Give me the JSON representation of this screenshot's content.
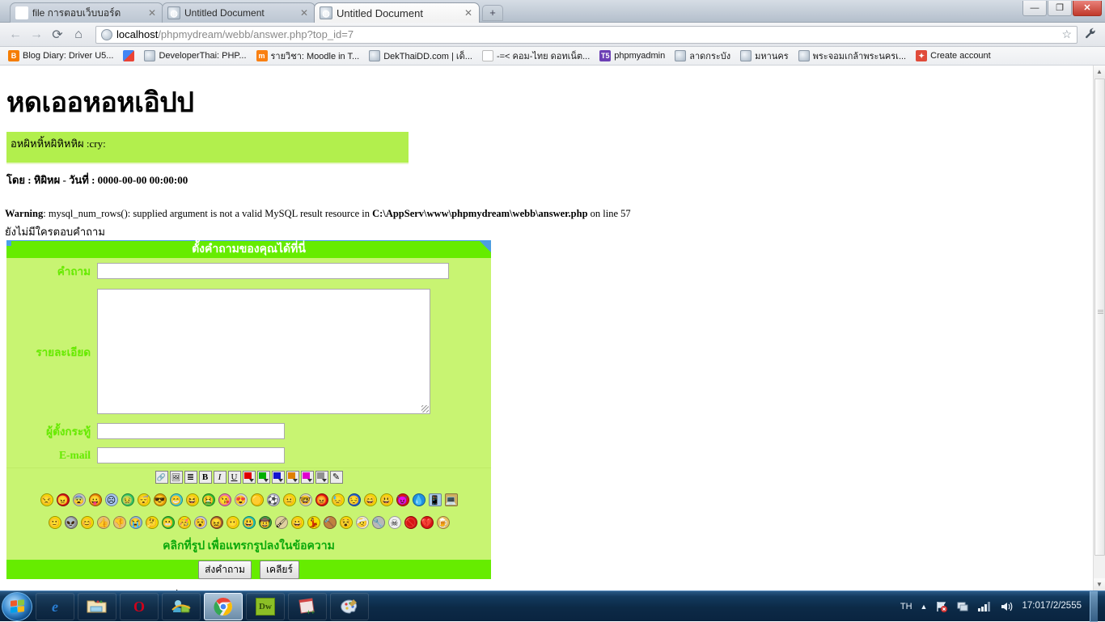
{
  "window": {
    "controls": {
      "minimize": "—",
      "maximize": "❐",
      "close": "✕"
    }
  },
  "tabs": [
    {
      "label": "file การตอบเว็บบอร์ด",
      "icon": "google-favicon",
      "active": false,
      "close": "✕"
    },
    {
      "label": "Untitled Document",
      "icon": "globe-favicon",
      "active": false,
      "close": "✕"
    },
    {
      "label": "Untitled Document",
      "icon": "globe-favicon",
      "active": true,
      "close": "✕"
    }
  ],
  "new_tab_label": "+",
  "nav": {
    "back_icon": "←",
    "forward_icon": "→",
    "reload_icon": "⟳",
    "home_icon": "⌂",
    "url_host": "localhost",
    "url_path": "/phpmydream/webb/answer.php?top_id=7",
    "url_full": "localhost/phpmydream/webb/answer.php?top_id=7",
    "star_icon": "☆",
    "wrench_icon": "🔧"
  },
  "bookmarks": [
    {
      "label": "Blog Diary: Driver U5...",
      "icon": "blogger-icon"
    },
    {
      "label": "",
      "icon": "google-icon"
    },
    {
      "label": "DeveloperThai: PHP...",
      "icon": "globe-icon"
    },
    {
      "label": "รายวิชา: Moodle in T...",
      "icon": "moodle-icon"
    },
    {
      "label": "DekThaiDD.com | เด็...",
      "icon": "globe-icon"
    },
    {
      "label": "-=< คอม-ไทย ดอทเน็ต...",
      "icon": "c-icon"
    },
    {
      "label": "phpmyadmin",
      "icon": "phpmyadmin-icon"
    },
    {
      "label": "ลาดกระบัง",
      "icon": "globe-icon"
    },
    {
      "label": "มหานคร",
      "icon": "globe-icon"
    },
    {
      "label": "พระจอมเกล้าพระนครเ...",
      "icon": "globe-icon"
    },
    {
      "label": "Create account",
      "icon": "account-icon"
    }
  ],
  "page": {
    "title": "หดเออหอหเอิปป",
    "post_text": "อหผิหหิ้หผิหิหหิผ :cry:",
    "post_meta": "โดย : หิผิหผ - วันที่ : 0000-00-00 00:00:00",
    "warning_prefix": "Warning",
    "warning_text": ": mysql_num_rows(): supplied argument is not a valid MySQL result resource in ",
    "warning_path": "C:\\AppServ\\www\\phpmydream\\webb\\answer.php",
    "warning_suffix": " on line 57",
    "no_answer_text": "ยังไม่มีใครตอบคำถาม"
  },
  "form": {
    "header": "ตั้งคำถามของคุณได้ที่นี่",
    "labels": {
      "question": "คำถาม",
      "detail": "รายละเอียด",
      "author": "ผู้ตั้งกระทู้",
      "email": "E-mail"
    },
    "values": {
      "question": "",
      "detail": "",
      "author": "",
      "email": ""
    },
    "toolbar": [
      {
        "name": "insert-link-icon",
        "glyph": "🔗"
      },
      {
        "name": "insert-image-icon",
        "glyph": "🖼"
      },
      {
        "name": "insert-list-icon",
        "glyph": "≣"
      },
      {
        "name": "bold-icon",
        "glyph": "B"
      },
      {
        "name": "italic-icon",
        "glyph": "I"
      },
      {
        "name": "underline-icon",
        "glyph": "U"
      },
      {
        "name": "color-red-icon",
        "color": "#e00000"
      },
      {
        "name": "color-green-icon",
        "color": "#00b000"
      },
      {
        "name": "color-blue-icon",
        "color": "#1414d0"
      },
      {
        "name": "color-orange-icon",
        "color": "#e08000"
      },
      {
        "name": "color-magenta-icon",
        "color": "#e000d0"
      },
      {
        "name": "color-gray-icon",
        "color": "#909090"
      },
      {
        "name": "edit-pencil-icon",
        "glyph": "✎"
      }
    ],
    "emoticons_row1": [
      {
        "name": "rolleyes-emoticon",
        "glyph": "😒",
        "bg": "#f5e000"
      },
      {
        "name": "mad-emoticon",
        "glyph": "😠",
        "bg": "#d01414"
      },
      {
        "name": "shocked-emoticon",
        "glyph": "😨",
        "bg": "#c8c8c8"
      },
      {
        "name": "tongue-emoticon",
        "glyph": "😛",
        "bg": "#e08000"
      },
      {
        "name": "sad-emoticon",
        "glyph": "☹",
        "bg": "#a8c8f0"
      },
      {
        "name": "sick-emoticon",
        "glyph": "🤢",
        "bg": "#30c860"
      },
      {
        "name": "sleep-emoticon",
        "glyph": "😴",
        "bg": "#f5e000"
      },
      {
        "name": "cool-emoticon",
        "glyph": "😎",
        "bg": "#e0a000"
      },
      {
        "name": "grin-emoticon",
        "glyph": "😁",
        "bg": "#40d0d0"
      },
      {
        "name": "laugh-emoticon",
        "glyph": "😆",
        "bg": "#f5e000"
      },
      {
        "name": "puke-emoticon",
        "glyph": "🤮",
        "bg": "#30c030"
      },
      {
        "name": "kiss-emoticon",
        "glyph": "😘",
        "bg": "#f070b0"
      },
      {
        "name": "inlove-emoticon",
        "glyph": "😍",
        "bg": "#d8d8d8"
      },
      {
        "name": "pacman-emoticon",
        "glyph": "🟡",
        "bg": "#f5d000"
      },
      {
        "name": "ball-emoticon",
        "glyph": "⚽",
        "bg": "#c0c0d8"
      },
      {
        "name": "blank-emoticon",
        "glyph": "😐",
        "bg": "#f5e000"
      },
      {
        "name": "nerd-emoticon",
        "glyph": "🤓",
        "bg": "#d8d8c0"
      },
      {
        "name": "angry-red-emoticon",
        "glyph": "😡",
        "bg": "#d81414"
      },
      {
        "name": "sweat-emoticon",
        "glyph": "😓",
        "bg": "#f5e000"
      },
      {
        "name": "blue-sad-emoticon",
        "glyph": "😔",
        "bg": "#2060d0"
      },
      {
        "name": "happy-emoticon",
        "glyph": "😄",
        "bg": "#f5e000"
      },
      {
        "name": "bigsmile-emoticon",
        "glyph": "😃",
        "bg": "#f5e000"
      },
      {
        "name": "devil-emoticon",
        "glyph": "😈",
        "bg": "#d81414"
      },
      {
        "name": "droplet-emoticon",
        "glyph": "💧",
        "bg": "#2090e0"
      },
      {
        "name": "mobile-phone-icon",
        "glyph": "📱",
        "bg": "#a8c8e8"
      },
      {
        "name": "computer-icon",
        "glyph": "💻",
        "bg": "#d0b060"
      }
    ],
    "emoticons_row2": [
      {
        "name": "smile-emoticon",
        "glyph": "🙂",
        "bg": "#f5e000"
      },
      {
        "name": "alien-emoticon",
        "glyph": "👽",
        "bg": "#909090"
      },
      {
        "name": "smile2-emoticon",
        "glyph": "😊",
        "bg": "#f5e000"
      },
      {
        "name": "thumbsup-icon",
        "glyph": "👍",
        "bg": "#e8c070"
      },
      {
        "name": "thumbsdown-icon",
        "glyph": "👎",
        "bg": "#e8c070"
      },
      {
        "name": "cry-emoticon",
        "glyph": "😭",
        "bg": "#90b8d8"
      },
      {
        "name": "think-emoticon",
        "glyph": "🤔",
        "bg": "#f5e000"
      },
      {
        "name": "greenmouth-emoticon",
        "glyph": "😬",
        "bg": "#30c030"
      },
      {
        "name": "party-emoticon",
        "glyph": "🥳",
        "bg": "#f5e000"
      },
      {
        "name": "dizzy-emoticon",
        "glyph": "😵",
        "bg": "#c0c8e0"
      },
      {
        "name": "brownface-emoticon",
        "glyph": "😖",
        "bg": "#a06030"
      },
      {
        "name": "plainyellow-emoticon",
        "glyph": "😶",
        "bg": "#f5e000"
      },
      {
        "name": "teal-emoticon",
        "glyph": "😃",
        "bg": "#20c8b0"
      },
      {
        "name": "cowboy-emoticon",
        "glyph": "🤠",
        "bg": "#40a040"
      },
      {
        "name": "painter-emoticon",
        "glyph": "🖌",
        "bg": "#e0d0a0"
      },
      {
        "name": "bigyellow-emoticon",
        "glyph": "😀",
        "bg": "#f5e000"
      },
      {
        "name": "dancer-emoticon",
        "glyph": "💃",
        "bg": "#f5e000"
      },
      {
        "name": "hammer-emoticon",
        "glyph": "🔨",
        "bg": "#c08040"
      },
      {
        "name": "hit-emoticon",
        "glyph": "😵",
        "bg": "#f5e000"
      },
      {
        "name": "bandage-emoticon",
        "glyph": "🤕",
        "bg": "#f0f0e0"
      },
      {
        "name": "hammer2-icon",
        "glyph": "🔧",
        "bg": "#b8b8b8"
      },
      {
        "name": "skull-icon",
        "glyph": "☠",
        "bg": "#f0f0f0"
      },
      {
        "name": "noentry-icon",
        "glyph": "🚫",
        "bg": "#d81414"
      },
      {
        "name": "brokenheart-icon",
        "glyph": "💔",
        "bg": "#d81414"
      },
      {
        "name": "beer-icon",
        "glyph": "🍺",
        "bg": "#e8c060"
      }
    ],
    "emoticon_hint": "คลิกที่รูป เพื่อแทรกรูปลงในข้อความ",
    "submit_label": "ส่งคำถาม",
    "clear_label": "เคลียร์"
  },
  "scrollbar": {
    "up_arrow": "▲",
    "down_arrow": "▼"
  },
  "taskbar": {
    "start_name": "windows-start-orb",
    "items": [
      {
        "name": "internet-explorer-icon",
        "glyph": "e"
      },
      {
        "name": "file-explorer-icon",
        "glyph": "📁"
      },
      {
        "name": "opera-icon",
        "glyph": "O"
      },
      {
        "name": "messenger-icon",
        "glyph": "👥"
      },
      {
        "name": "google-chrome-icon",
        "glyph": "◍",
        "active": true
      },
      {
        "name": "dreamweaver-icon",
        "glyph": "Dw"
      },
      {
        "name": "notepadpp-icon",
        "glyph": "📝"
      },
      {
        "name": "paint-icon",
        "glyph": "🎨"
      }
    ],
    "tray": {
      "language": "TH",
      "show_hidden_icon": "▲",
      "flag_icon": "⚑",
      "action_center_icon": "🗔",
      "network_icon": "▂▄▆",
      "volume_icon": "🔊",
      "time": "17:01",
      "date": "7/2/2555"
    }
  }
}
